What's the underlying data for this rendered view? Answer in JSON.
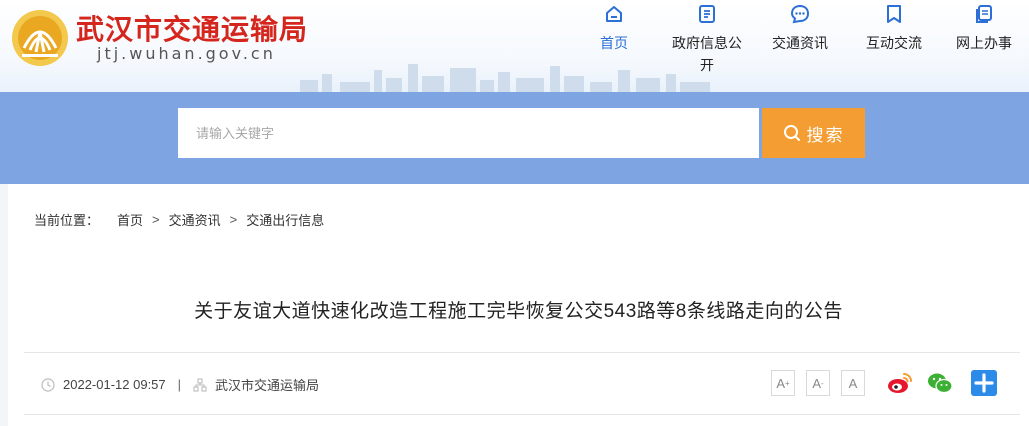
{
  "header": {
    "site_title": "武汉市交通运输局",
    "site_domain": "jtj.wuhan.gov.cn",
    "nav": [
      {
        "label": "首页",
        "icon": "home-icon",
        "active": true
      },
      {
        "label": "政府信息公开",
        "icon": "document-icon",
        "active": false
      },
      {
        "label": "交通资讯",
        "icon": "chat-icon",
        "active": false
      },
      {
        "label": "互动交流",
        "icon": "bookmark-icon",
        "active": false
      },
      {
        "label": "网上办事",
        "icon": "files-icon",
        "active": false
      }
    ]
  },
  "search": {
    "placeholder": "请输入关键字",
    "button_label": "搜索"
  },
  "breadcrumb": {
    "lead": "当前位置：",
    "items": [
      "首页",
      "交通资讯",
      "交通出行信息"
    ],
    "separator": ">"
  },
  "article": {
    "title": "关于友谊大道快速化改造工程施工完毕恢复公交543路等8条线路走向的公告",
    "date": "2022-01-12 09:57",
    "meta_separator": "|",
    "source": "武汉市交通运输局"
  },
  "font_controls": [
    "A",
    "A",
    "A"
  ],
  "share": [
    "weibo-icon",
    "wechat-icon",
    "more-share-icon"
  ],
  "colors": {
    "brand_red": "#d5261e",
    "nav_active": "#2c6fd6",
    "search_band": "#7ea5e2",
    "search_button": "#f49d33"
  }
}
